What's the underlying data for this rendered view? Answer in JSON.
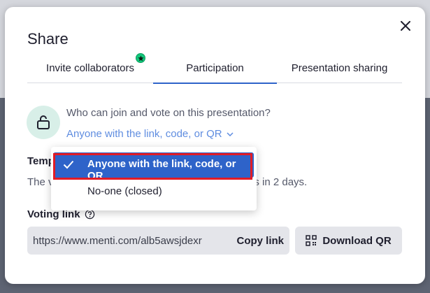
{
  "dialog": {
    "title": "Share",
    "close_icon": "close-icon"
  },
  "tabs": [
    {
      "label": "Invite collaborators",
      "badge_icon": "star-icon",
      "badge_color": "#13c77b"
    },
    {
      "label": "Participation",
      "active": true
    },
    {
      "label": "Presentation sharing"
    }
  ],
  "access": {
    "icon": "lock-open-icon",
    "question": "Who can join and vote on this presentation?",
    "selected": "Anyone with the link, code, or QR"
  },
  "dropdown": {
    "options": [
      {
        "label": "Anyone with the link, code, or QR",
        "selected": true
      },
      {
        "label": "No-one (closed)",
        "selected": false
      }
    ]
  },
  "temporary": {
    "heading_partial": "Temp",
    "text_partial_left": "The v",
    "text_partial_right": "es in 2 days."
  },
  "voting_link": {
    "label": "Voting link",
    "help_icon": "question-circle-icon",
    "url": "https://www.menti.com/alb5awsjdexr",
    "copy_label": "Copy link",
    "qr_icon": "qr-code-icon",
    "download_qr_label": "Download QR"
  },
  "colors": {
    "accent": "#2e63c9",
    "link": "#5f8de0",
    "highlight": "#e21b25"
  }
}
